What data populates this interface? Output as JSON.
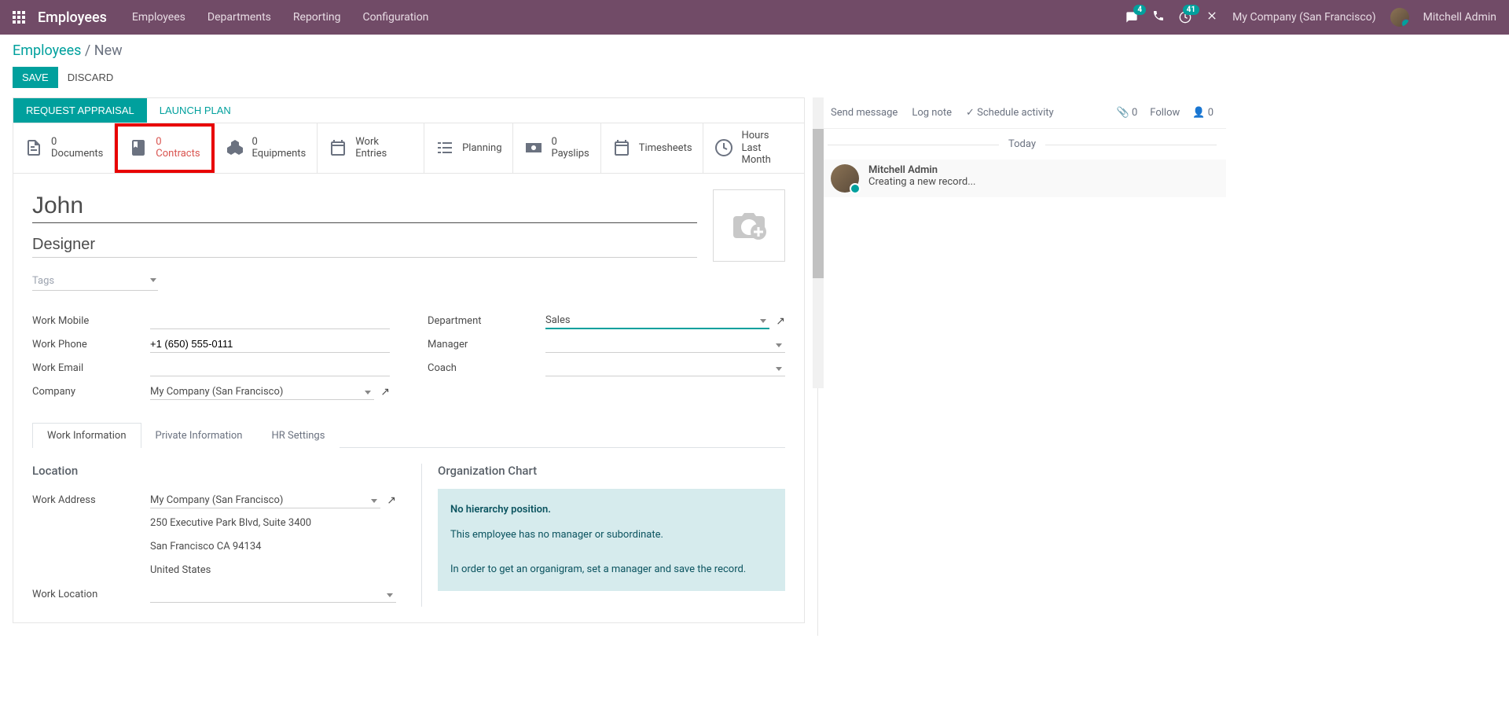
{
  "topnav": {
    "brand": "Employees",
    "links": [
      "Employees",
      "Departments",
      "Reporting",
      "Configuration"
    ],
    "messages_badge": "4",
    "activities_badge": "41",
    "company": "My Company (San Francisco)",
    "user": "Mitchell Admin"
  },
  "breadcrumb": {
    "root": "Employees",
    "current": "New"
  },
  "actions": {
    "save": "SAVE",
    "discard": "DISCARD"
  },
  "statusbar": {
    "request_appraisal": "REQUEST APPRAISAL",
    "launch_plan": "LAUNCH PLAN"
  },
  "stat_buttons": [
    {
      "count": "0",
      "label": "Documents"
    },
    {
      "count": "0",
      "label": "Contracts"
    },
    {
      "count": "0",
      "label": "Equipments"
    },
    {
      "count": "",
      "label": "Work Entries"
    },
    {
      "count": "",
      "label": "Planning"
    },
    {
      "count": "0",
      "label": "Payslips"
    },
    {
      "count": "",
      "label": "Timesheets"
    },
    {
      "count": "Hours",
      "label": "Last Month"
    }
  ],
  "form": {
    "name": "John",
    "job_title": "Designer",
    "tags_placeholder": "Tags",
    "left_fields": {
      "work_mobile_label": "Work Mobile",
      "work_mobile": "",
      "work_phone_label": "Work Phone",
      "work_phone": "+1 (650) 555-0111",
      "work_email_label": "Work Email",
      "work_email": "",
      "company_label": "Company",
      "company": "My Company (San Francisco)"
    },
    "right_fields": {
      "department_label": "Department",
      "department": "Sales",
      "manager_label": "Manager",
      "manager": "",
      "coach_label": "Coach",
      "coach": ""
    }
  },
  "notebook": {
    "tabs": [
      "Work Information",
      "Private Information",
      "HR Settings"
    ],
    "location_section": "Location",
    "work_address_label": "Work Address",
    "work_address": "My Company (San Francisco)",
    "address_lines": [
      "250 Executive Park Blvd, Suite 3400",
      "San Francisco CA 94134",
      "United States"
    ],
    "work_location_label": "Work Location",
    "org_title": "Organization Chart",
    "org_box": {
      "heading": "No hierarchy position.",
      "line1": "This employee has no manager or subordinate.",
      "line2": "In order to get an organigram, set a manager and save the record."
    }
  },
  "chatter": {
    "send_message": "Send message",
    "log_note": "Log note",
    "schedule_activity": "Schedule activity",
    "attach_count": "0",
    "follow": "Follow",
    "follower_count": "0",
    "today": "Today",
    "msg_author": "Mitchell Admin",
    "msg_text": "Creating a new record..."
  }
}
